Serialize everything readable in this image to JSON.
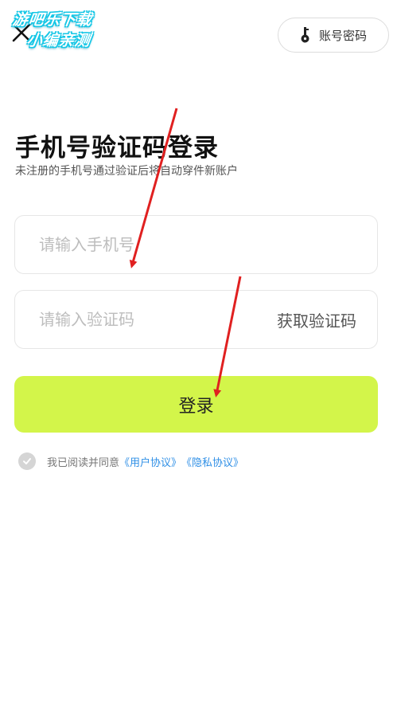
{
  "watermark": {
    "line1": "游吧乐下载",
    "line2": "小编亲测"
  },
  "header": {
    "password_login_label": "账号密码"
  },
  "title": "手机号验证码登录",
  "subtitle": "未注册的手机号通过验证后将自动穿件新账户",
  "phone_field": {
    "placeholder": "请输入手机号",
    "value": ""
  },
  "code_field": {
    "placeholder": "请输入验证码",
    "value": "",
    "get_code_label": "获取验证码"
  },
  "login_button_label": "登录",
  "agreement": {
    "prefix": "我已阅读并同意",
    "user_agreement": "《用户协议》",
    "privacy_policy": "《隐私协议》"
  },
  "colors": {
    "login_button": "#d3f54a",
    "link": "#2f8fe6",
    "annotation_arrow": "#e02020"
  }
}
